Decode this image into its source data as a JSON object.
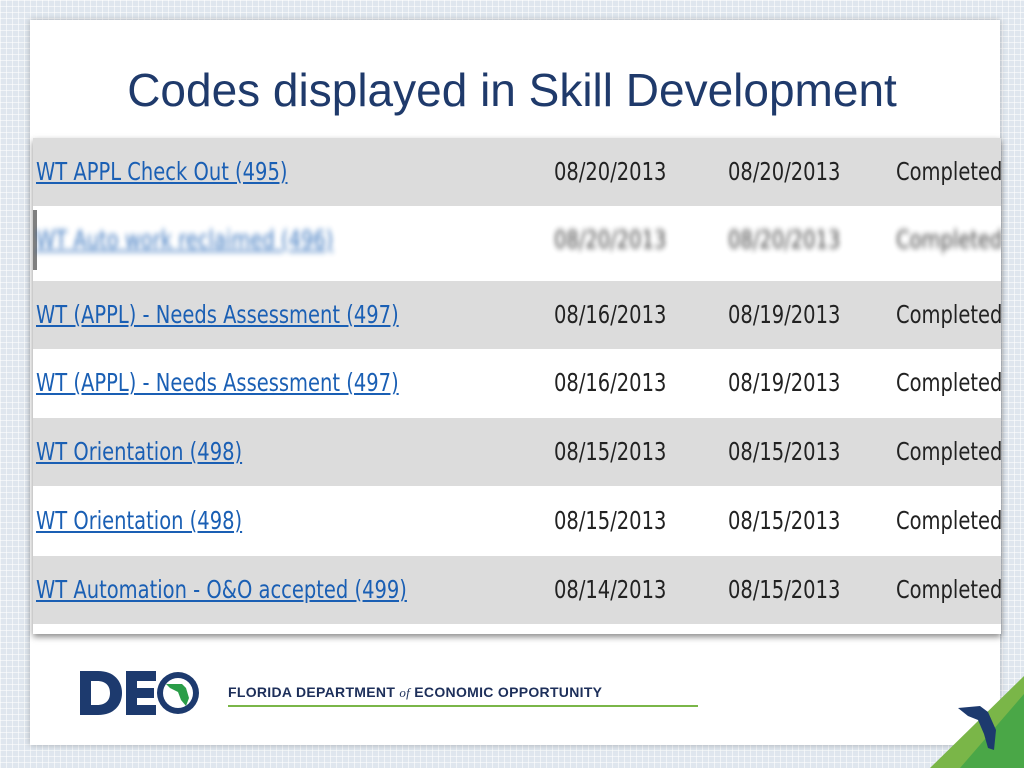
{
  "slide": {
    "title": "Codes displayed in Skill Development"
  },
  "table": {
    "rows": [
      {
        "activity": "WT APPL Check Out (495)",
        "start": "08/20/2013",
        "end": "08/20/2013",
        "status": "Completed",
        "blurred": false
      },
      {
        "activity": "WT Auto work reclaimed (496)",
        "start": "08/20/2013",
        "end": "08/20/2013",
        "status": "Completed",
        "blurred": true
      },
      {
        "activity": "WT (APPL) - Needs Assessment (497)",
        "start": "08/16/2013",
        "end": "08/19/2013",
        "status": "Completed",
        "blurred": false
      },
      {
        "activity": "WT (APPL) - Needs Assessment (497)",
        "start": "08/16/2013",
        "end": "08/19/2013",
        "status": "Completed",
        "blurred": false
      },
      {
        "activity": "WT Orientation (498)",
        "start": "08/15/2013",
        "end": "08/15/2013",
        "status": "Completed",
        "blurred": false
      },
      {
        "activity": "WT Orientation (498)",
        "start": "08/15/2013",
        "end": "08/15/2013",
        "status": "Completed",
        "blurred": false
      },
      {
        "activity": "WT Automation - O&O accepted (499)",
        "start": "08/14/2013",
        "end": "08/15/2013",
        "status": "Completed",
        "blurred": false
      }
    ]
  },
  "footer": {
    "logo_text": "DEO",
    "agency_part1": "FLORIDA DEPARTMENT",
    "agency_of": "of",
    "agency_part2": "ECONOMIC OPPORTUNITY"
  },
  "colors": {
    "title": "#1f3a6b",
    "link": "#1a5fb4",
    "row_shaded": "#dcdcdc",
    "logo_navy": "#1d3a6e",
    "logo_green": "#2a9d48",
    "accent_green": "#7ab648"
  }
}
